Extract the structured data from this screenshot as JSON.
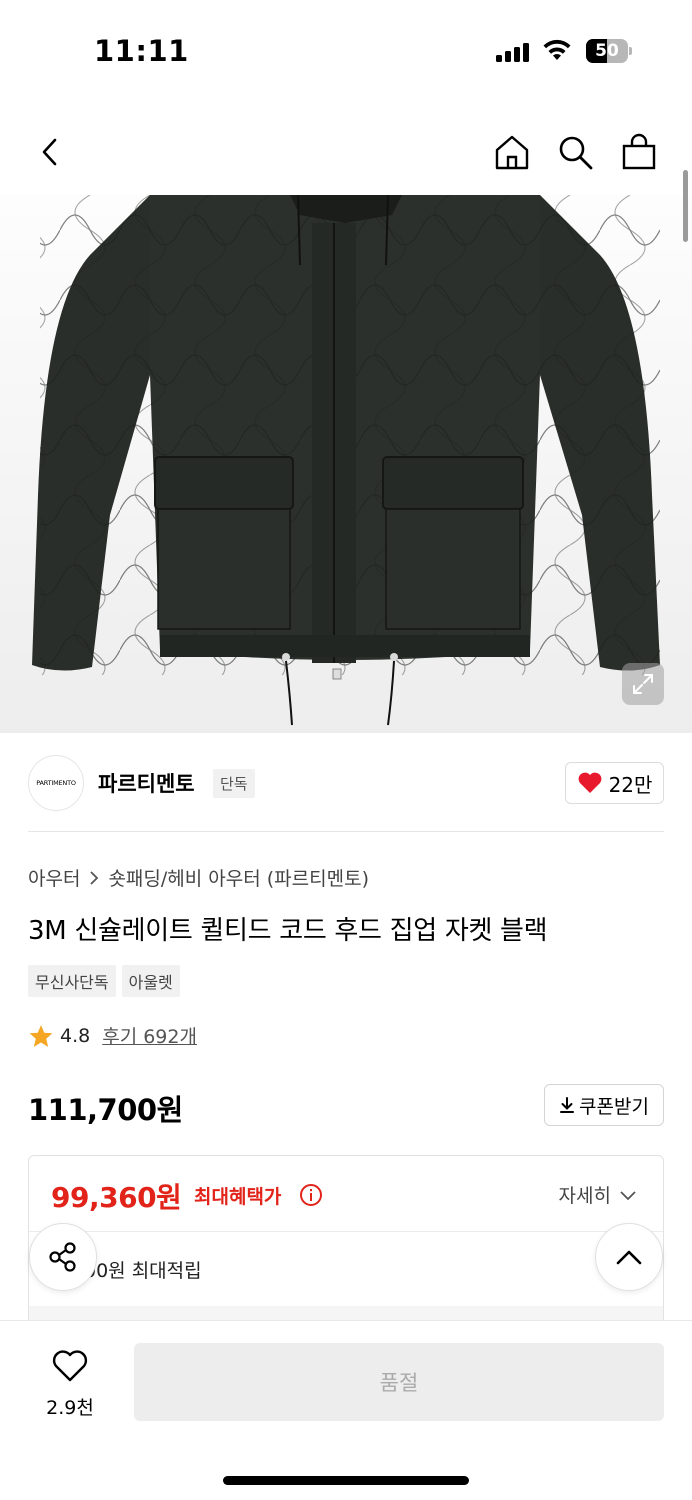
{
  "status_bar": {
    "time": "11:11",
    "battery": "50",
    "battery_level": 0.5
  },
  "nav": {
    "back_icon": "back-arrow-icon",
    "home_icon": "home-icon",
    "search_icon": "search-icon",
    "cart_icon": "shopping-bag-icon"
  },
  "image": {
    "expand_icon": "expand-icon"
  },
  "brand": {
    "logo_text": "PARTIMENTO",
    "name": "파르티멘토",
    "badge": "단독",
    "likes": "22만"
  },
  "product": {
    "breadcrumb": [
      "아우터",
      "숏패딩/헤비 아우터 (파르티멘토)"
    ],
    "title": "3M 신슐레이트 퀼티드 코드 후드 집업 자켓 블랙",
    "tags": [
      "무신사단독",
      "아울렛"
    ],
    "rating": "4.8",
    "reviews": "후기 692개",
    "price": "111,700원",
    "coupon_label": "쿠폰받기"
  },
  "benefit": {
    "best_price": "99,360원",
    "best_label": "최대혜택가",
    "details_label": "자세히",
    "points": "00원 최대적립"
  },
  "bottom": {
    "wish_count": "2.9천",
    "soldout_label": "품절"
  },
  "colors": {
    "accent_red": "#e2231a",
    "heart_red": "#e8192c",
    "star": "#f5a623"
  }
}
